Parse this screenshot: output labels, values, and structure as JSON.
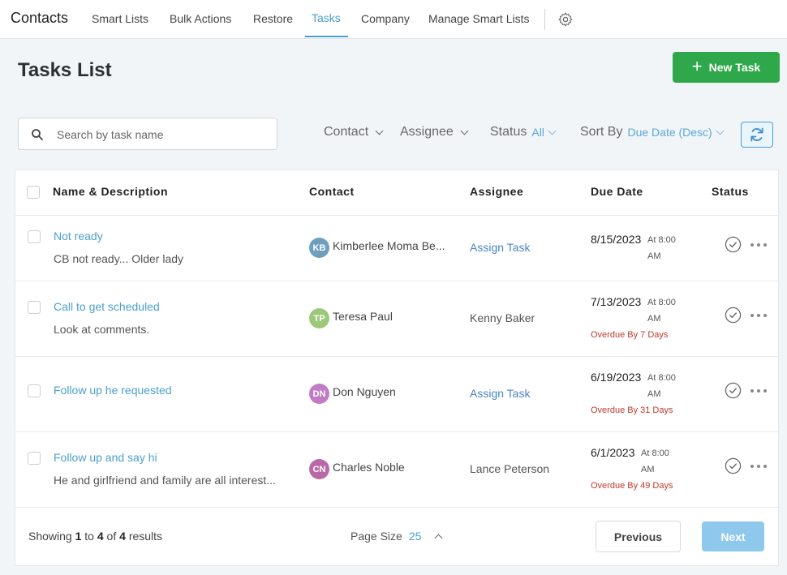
{
  "nav": {
    "app_title": "Contacts",
    "items": [
      {
        "label": "Smart Lists"
      },
      {
        "label": "Bulk Actions"
      },
      {
        "label": "Restore"
      },
      {
        "label": "Tasks"
      },
      {
        "label": "Company"
      },
      {
        "label": "Manage Smart Lists"
      }
    ],
    "active": "Tasks",
    "settings_icon": "gear-icon"
  },
  "header": {
    "title": "Tasks List",
    "new_task_label": "New Task"
  },
  "filters": {
    "search_placeholder": "Search by task name",
    "contact_label": "Contact",
    "assignee_label": "Assignee",
    "status_label": "Status",
    "status_value": "All",
    "sort_label": "Sort By",
    "sort_value": "Due Date (Desc)",
    "refresh_icon": "refresh-icon"
  },
  "table": {
    "columns": [
      "Name & Description",
      "Contact",
      "Assignee",
      "Due Date",
      "Status"
    ],
    "rows": [
      {
        "name": "Not ready",
        "description": "CB not ready... Older lady",
        "contact_initials": "KB",
        "contact_name": "Kimberlee Moma Be...",
        "avatar_color": "#6f9fbe",
        "assignee": "Assign Task",
        "due_date": "8/15/2023",
        "due_time": "At 8:00 AM",
        "overdue": ""
      },
      {
        "name": "Call to get scheduled",
        "description": "Look at comments.",
        "contact_initials": "TP",
        "contact_name": "Teresa Paul",
        "avatar_color": "#9cc87a",
        "assignee": "Kenny Baker",
        "due_date": "7/13/2023",
        "due_time": "At 8:00 AM",
        "overdue": "Overdue By 7 Days"
      },
      {
        "name": "Follow up he requested",
        "description": "",
        "contact_initials": "DN",
        "contact_name": "Don Nguyen",
        "avatar_color": "#c07cc4",
        "assignee": "Assign Task",
        "due_date": "6/19/2023",
        "due_time": "At 8:00 AM",
        "overdue": "Overdue By 31 Days"
      },
      {
        "name": "Follow up and say hi",
        "description": "He and girlfriend and family are all interest...",
        "contact_initials": "CN",
        "contact_name": "Charles Noble",
        "avatar_color": "#b96aa6",
        "assignee": "Lance Peterson",
        "due_date": "6/1/2023",
        "due_time": "At 8:00 AM",
        "overdue": "Overdue By 49 Days"
      }
    ]
  },
  "footer": {
    "showing_prefix": "Showing",
    "from": "1",
    "to_word": "to",
    "to": "4",
    "of_word": "of",
    "total": "4",
    "results_word": "results",
    "page_size_label": "Page Size",
    "page_size_value": "25",
    "previous_label": "Previous",
    "next_label": "Next"
  },
  "colors": {
    "accent": "#4a9fd0",
    "primary_button": "#2ea84a",
    "overdue": "#c0392b"
  }
}
